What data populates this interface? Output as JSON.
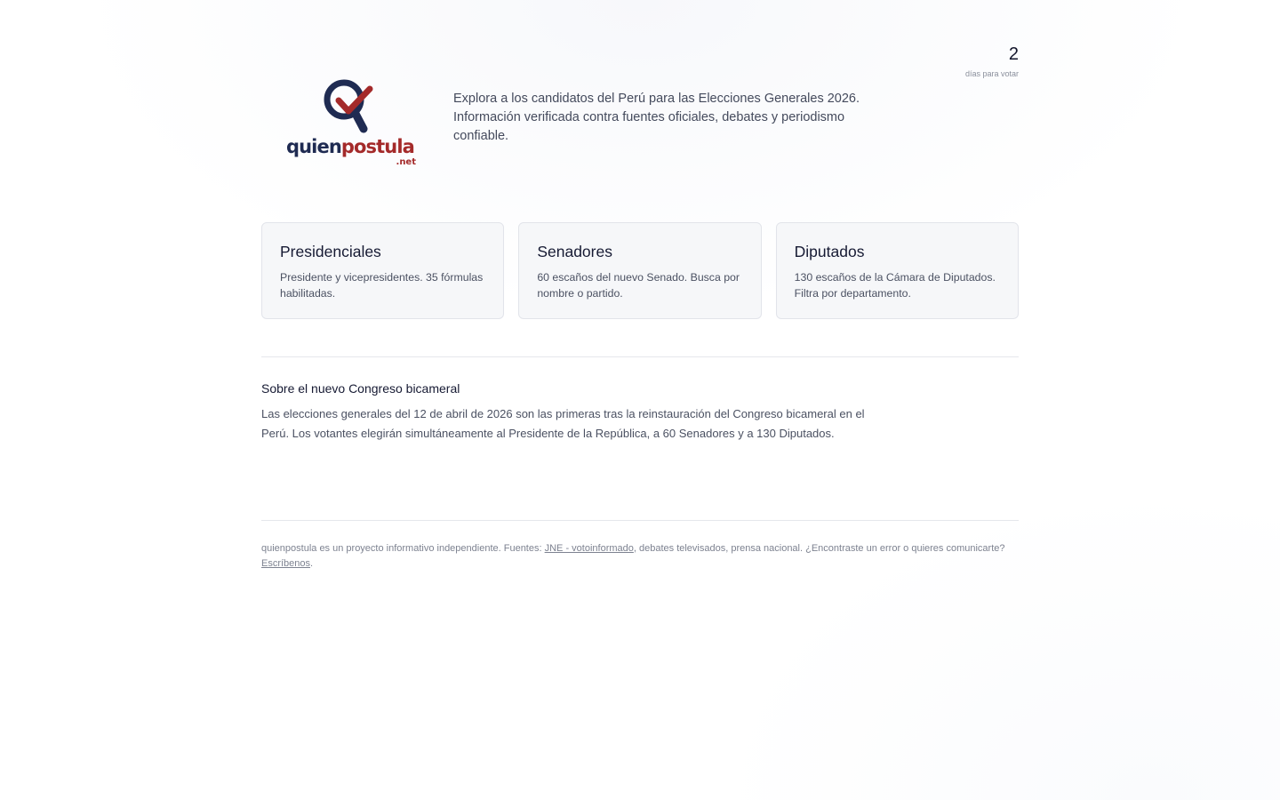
{
  "countdown": {
    "value": "2",
    "label": "días para votar"
  },
  "logo": {
    "word_part1": "quien",
    "word_part2": "postula",
    "suffix": ".net",
    "colors": {
      "navy": "#1f2b52",
      "red": "#a42a2a"
    }
  },
  "intro": "Explora a los candidatos del Perú para las Elecciones Generales 2026. Información verificada contra fuentes oficiales, debates y periodismo confiable.",
  "cards": [
    {
      "title": "Presidenciales",
      "description": "Presidente y vicepresidentes. 35 fórmulas habilitadas."
    },
    {
      "title": "Senadores",
      "description": "60 escaños del nuevo Senado. Busca por nombre o partido."
    },
    {
      "title": "Diputados",
      "description": "130 escaños de la Cámara de Diputados. Filtra por departamento."
    }
  ],
  "about": {
    "title": "Sobre el nuevo Congreso bicameral",
    "text": "Las elecciones generales del 12 de abril de 2026 son las primeras tras la reinstauración del Congreso bicameral en el Perú. Los votantes elegirán simultáneamente al Presidente de la República, a 60 Senadores y a 130 Diputados."
  },
  "footer": {
    "text_before_link": "quienpostula es un proyecto informativo independiente. Fuentes: ",
    "sources_link": "JNE - votoinformado",
    "text_middle": ", debates televisados, prensa nacional. ¿Encontraste un error o quieres comunicarte? ",
    "contact_link": "Escríbenos",
    "text_end": "."
  }
}
